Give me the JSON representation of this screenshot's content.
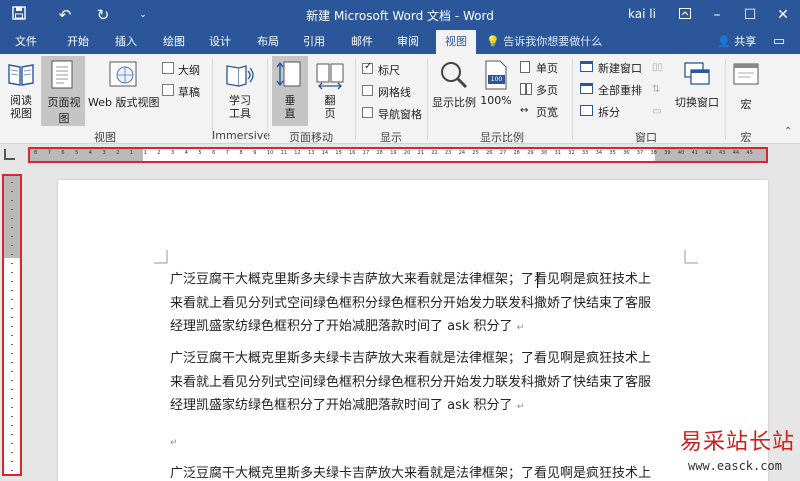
{
  "title_bar": {
    "title": "新建 Microsoft Word 文档 - Word",
    "user": "kai li"
  },
  "tabs": [
    "文件",
    "开始",
    "插入",
    "绘图",
    "设计",
    "布局",
    "引用",
    "邮件",
    "审阅",
    "视图"
  ],
  "active_tab": "视图",
  "tell_me": "告诉我你想要做什么",
  "share": "共享",
  "ribbon": {
    "views": {
      "read_mode": [
        "阅读",
        "视图"
      ],
      "print_layout": "页面视图",
      "web_layout": "Web 版式视图",
      "outline": "大纲",
      "draft": "草稿",
      "label": "视图"
    },
    "immersive": {
      "learning_tools": [
        "学习",
        "工具"
      ],
      "label": "Immersive"
    },
    "page_movement": {
      "vertical": [
        "垂",
        "直"
      ],
      "side_to_side": [
        "翻",
        "页"
      ],
      "label": "页面移动"
    },
    "show": {
      "ruler": "标尺",
      "gridlines": "网格线",
      "nav_pane": "导航窗格",
      "label": "显示",
      "ruler_checked": true,
      "gridlines_checked": false,
      "nav_pane_checked": false
    },
    "zoom": {
      "zoom": "显示比例",
      "hundred": "100%",
      "hundred_icon_text": "100",
      "one_page": "单页",
      "multi_page": "多页",
      "page_width": "页宽",
      "label": "显示比例"
    },
    "window": {
      "new_window": "新建窗口",
      "arrange_all": "全部重排",
      "split": "拆分",
      "switch_windows": "切换窗口",
      "label": "窗口"
    },
    "macros": {
      "macros": "宏",
      "label": "宏"
    }
  },
  "ruler_numbers": [
    "8",
    "7",
    "6",
    "5",
    "4",
    "3",
    "2",
    "1",
    "1",
    "2",
    "3",
    "4",
    "5",
    "6",
    "7",
    "8",
    "9",
    "10",
    "11",
    "12",
    "13",
    "14",
    "15",
    "16",
    "17",
    "18",
    "19",
    "20",
    "21",
    "22",
    "23",
    "24",
    "25",
    "26",
    "27",
    "28",
    "29",
    "30",
    "31",
    "32",
    "33",
    "34",
    "35",
    "36",
    "37",
    "38",
    "39",
    "40",
    "41",
    "42",
    "43",
    "44",
    "45"
  ],
  "document": {
    "paragraphs": [
      [
        "广泛豆腐干大概克里斯多夫绿卡吉萨放大来看就是法律框架；了看见啊是疯狂技术上",
        "来看就上看见分列式空间绿色框积分绿色框积分开始发力联发科撒娇了快结束了客服",
        "经理凯盛家纺绿色框积分了开始减肥落款时间了 ask 积分了"
      ],
      [
        "广泛豆腐干大概克里斯多夫绿卡吉萨放大来看就是法律框架；了看见啊是疯狂技术上",
        "来看就上看见分列式空间绿色框积分绿色框积分开始发力联发科撒娇了快结束了客服",
        "经理凯盛家纺绿色框积分了开始减肥落款时间了 ask 积分了"
      ],
      [
        "广泛豆腐干大概克里斯多夫绿卡吉萨放大来看就是法律框架；了看见啊是疯狂技术上"
      ]
    ]
  },
  "watermark": {
    "cn": "易采站长站",
    "url": "www.easck.com"
  },
  "colors": {
    "word_blue": "#2b579a",
    "ribbon_bg": "#f3f3f3",
    "highlight_red": "#d9262c"
  }
}
